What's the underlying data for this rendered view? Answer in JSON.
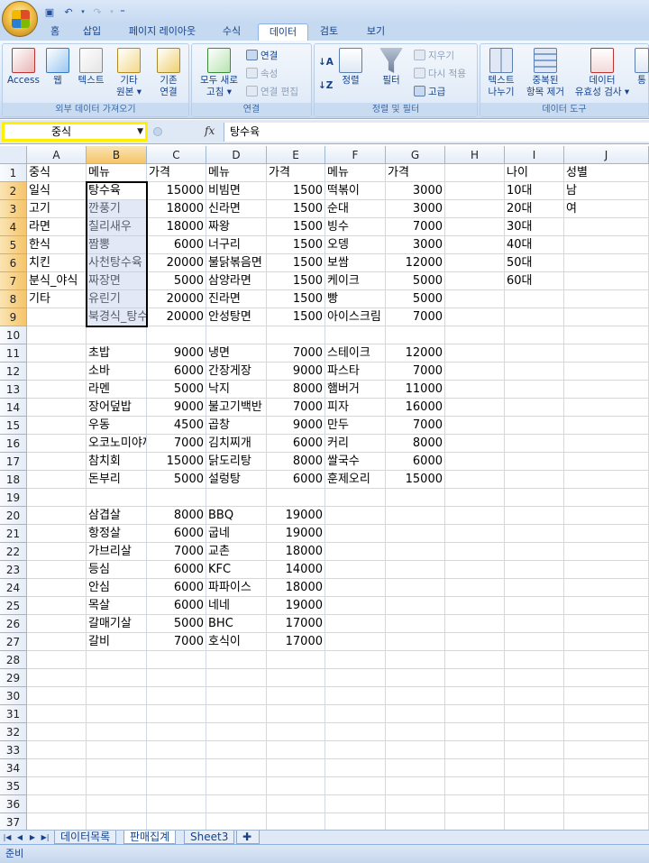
{
  "qat": {
    "save_icon": "save-icon",
    "undo_icon": "undo-icon",
    "redo_icon": "redo-icon",
    "more": "⁼"
  },
  "tabs": [
    "홈",
    "삽입",
    "페이지 레이아웃",
    "수식",
    "데이터",
    "검토",
    "보기"
  ],
  "active_tab": "데이터",
  "ribbon": {
    "external": {
      "label": "외부 데이터 가져오기",
      "access": "Access",
      "web": "웹",
      "text": "텍스트",
      "other1": "기타",
      "other2": "원본 ▾",
      "existing1": "기존",
      "existing2": "연결"
    },
    "connections": {
      "label": "연결",
      "refresh1": "모두 새로",
      "refresh2": "고침 ▾",
      "conn": "연결",
      "props": "속성",
      "edit": "연결 편집"
    },
    "sort": {
      "label": "정렬 및 필터",
      "sort": "정렬",
      "filter": "필터",
      "clear": "지우기",
      "reapply": "다시 적용",
      "advanced": "고급"
    },
    "tools": {
      "label": "데이터 도구",
      "t2c1": "텍스트",
      "t2c2": "나누기",
      "dup1": "중복된",
      "dup2": "항목 제거",
      "val1": "데이터",
      "val2": "유효성 검사 ▾",
      "more": "통"
    }
  },
  "formula_bar": {
    "name_box": "중식",
    "fx": "fx",
    "formula": "탕수육"
  },
  "columns": [
    "A",
    "B",
    "C",
    "D",
    "E",
    "F",
    "G",
    "H",
    "I",
    "J"
  ],
  "selected_column": "B",
  "rows_visible": 37,
  "cells": {
    "1": [
      "중식",
      "메뉴",
      "가격",
      "메뉴",
      "가격",
      "메뉴",
      "가격",
      "",
      "나이",
      "성별"
    ],
    "2": [
      "일식",
      "탕수육",
      "15000",
      "비빔면",
      "1500",
      "떡볶이",
      "3000",
      "",
      "10대",
      "남"
    ],
    "3": [
      "고기",
      "깐풍기",
      "18000",
      "신라면",
      "1500",
      "순대",
      "3000",
      "",
      "20대",
      "여"
    ],
    "4": [
      "라면",
      "칠리새우",
      "18000",
      "짜왕",
      "1500",
      "빙수",
      "7000",
      "",
      "30대",
      ""
    ],
    "5": [
      "한식",
      "짬뽕",
      "6000",
      "너구리",
      "1500",
      "오뎅",
      "3000",
      "",
      "40대",
      ""
    ],
    "6": [
      "치킨",
      "사천탕수육",
      "20000",
      "불닭볶음면",
      "1500",
      "보쌈",
      "12000",
      "",
      "50대",
      ""
    ],
    "7": [
      "분식_야식",
      "짜장면",
      "5000",
      "삼양라면",
      "1500",
      "케이크",
      "5000",
      "",
      "60대",
      ""
    ],
    "8": [
      "기타",
      "유린기",
      "20000",
      "진라면",
      "1500",
      "빵",
      "5000",
      "",
      "",
      ""
    ],
    "9": [
      "",
      "북경식_탕수육",
      "20000",
      "안성탕면",
      "1500",
      "아이스크림",
      "7000",
      "",
      "",
      ""
    ],
    "11": [
      "",
      "초밥",
      "9000",
      "냉면",
      "7000",
      "스테이크",
      "12000",
      "",
      "",
      ""
    ],
    "12": [
      "",
      "소바",
      "6000",
      "간장게장",
      "9000",
      "파스타",
      "7000",
      "",
      "",
      ""
    ],
    "13": [
      "",
      "라멘",
      "5000",
      "낙지",
      "8000",
      "햄버거",
      "11000",
      "",
      "",
      ""
    ],
    "14": [
      "",
      "장어덮밥",
      "9000",
      "불고기백반",
      "7000",
      "피자",
      "16000",
      "",
      "",
      ""
    ],
    "15": [
      "",
      "우동",
      "4500",
      "곱창",
      "9000",
      "만두",
      "7000",
      "",
      "",
      ""
    ],
    "16": [
      "",
      "오코노미야끼",
      "7000",
      "김치찌개",
      "6000",
      "커리",
      "8000",
      "",
      "",
      ""
    ],
    "17": [
      "",
      "참치회",
      "15000",
      "닭도리탕",
      "8000",
      "쌀국수",
      "6000",
      "",
      "",
      ""
    ],
    "18": [
      "",
      "돈부리",
      "5000",
      "설렁탕",
      "6000",
      "훈제오리",
      "15000",
      "",
      "",
      ""
    ],
    "20": [
      "",
      "삼겹살",
      "8000",
      "BBQ",
      "19000",
      "",
      "",
      "",
      "",
      ""
    ],
    "21": [
      "",
      "항정살",
      "6000",
      "굽네",
      "19000",
      "",
      "",
      "",
      "",
      ""
    ],
    "22": [
      "",
      "가브리살",
      "7000",
      "교촌",
      "18000",
      "",
      "",
      "",
      "",
      ""
    ],
    "23": [
      "",
      "등심",
      "6000",
      "KFC",
      "14000",
      "",
      "",
      "",
      "",
      ""
    ],
    "24": [
      "",
      "안심",
      "6000",
      "파파이스",
      "18000",
      "",
      "",
      "",
      "",
      ""
    ],
    "25": [
      "",
      "목살",
      "6000",
      "네네",
      "19000",
      "",
      "",
      "",
      "",
      ""
    ],
    "26": [
      "",
      "갈매기살",
      "5000",
      "BHC",
      "17000",
      "",
      "",
      "",
      "",
      ""
    ],
    "27": [
      "",
      "갈비",
      "7000",
      "호식이",
      "17000",
      "",
      "",
      "",
      "",
      ""
    ]
  },
  "sheets": [
    "데이터목록",
    "판매집계",
    "Sheet3"
  ],
  "active_sheet": "판매집계",
  "status": "준비"
}
